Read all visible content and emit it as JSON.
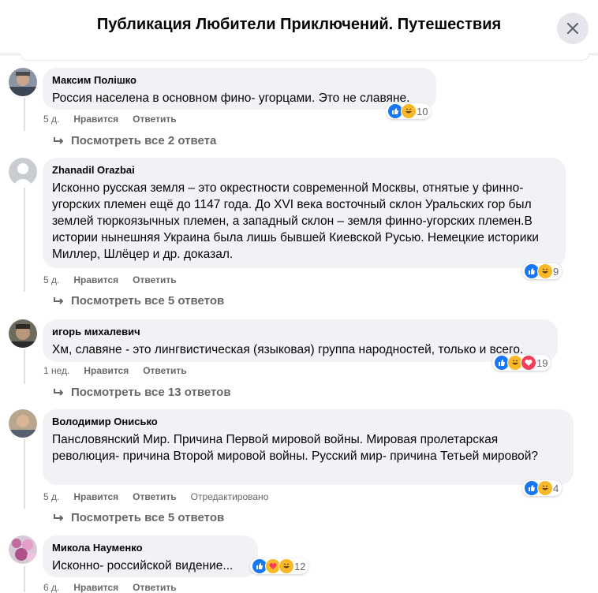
{
  "header": {
    "title": "Публикация Любители Приключений. Путешествия"
  },
  "comments": [
    {
      "author": "Максим Полішко",
      "text": "Россия населена в основном фино- угорцами. Это не славяне.",
      "time": "5 д.",
      "like_label": "Нравится",
      "reply_label": "Ответить",
      "reaction_count": "10",
      "replies": "Посмотреть все 2 ответа"
    },
    {
      "author": "Zhanadil Orazbai",
      "text": "Исконно русская земля – это окрестности современной Москвы, отнятые у финно-угорских племен ещё до 1147 года. До XVI века восточный склон Уральских гор был землей тюркоязычных племен, а западный склон – земля финно-угорских племен.В истории нынешняя Украина была лишь бывшей Киевской Русью. Немецкие историки Миллер, Шлёцер и др. доказал.",
      "time": "5 д.",
      "like_label": "Нравится",
      "reply_label": "Ответить",
      "reaction_count": "9",
      "replies": "Посмотреть все 5 ответов"
    },
    {
      "author": "игорь михалевич",
      "text": "Хм, славяне - это лингвистическая (языковая) группа народностей, только и всего.",
      "time": "1 нед.",
      "like_label": "Нравится",
      "reply_label": "Ответить",
      "reaction_count": "19",
      "replies": "Посмотреть все 13 ответов"
    },
    {
      "author": "Володимир Онисько",
      "text": "Пансловянский Мир. Причина Первой мировой войны. Мировая пролетарская революция- причина Второй мировой войны. Русский мир- причина Тетьей мировой?",
      "time": "5 д.",
      "like_label": "Нравится",
      "reply_label": "Ответить",
      "edited": "Отредактировано",
      "reaction_count": "4",
      "replies": "Посмотреть все 5 ответов"
    },
    {
      "author": "Микола Науменко",
      "text": "Исконно- российской видение...",
      "time": "6 д.",
      "like_label": "Нравится",
      "reply_label": "Ответить",
      "reaction_count": "12"
    }
  ],
  "colors": {
    "like": "#1877f2",
    "haha": "#f7b928",
    "love": "#f33e58",
    "bubble": "#f0f2f5",
    "meta": "#65676b"
  }
}
